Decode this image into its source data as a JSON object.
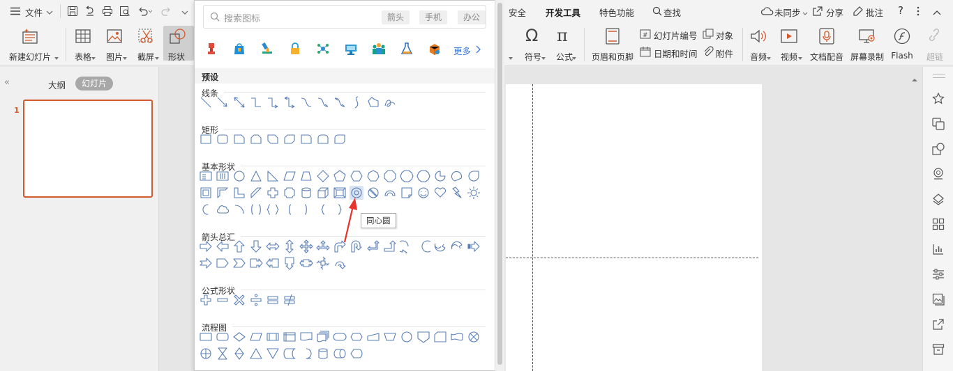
{
  "menubar": {
    "file": "文件",
    "tabs": [
      "安全",
      "开发工具",
      "特色功能"
    ],
    "search": "查找",
    "sync": "未同步",
    "share": "分享",
    "comment": "批注",
    "help": "?"
  },
  "ribbon": {
    "new_slide": "新建幻灯片",
    "table": "表格",
    "picture": "图片",
    "screenshot": "截屏",
    "shape": "形状",
    "symbol": "符号",
    "formula": "公式",
    "header_footer": "页眉和页脚",
    "slide_number": "幻灯片编号",
    "object": "对象",
    "date_time": "日期和时间",
    "attachment": "附件",
    "audio": "音频",
    "video": "视频",
    "doc_voice": "文档配音",
    "screen_record": "屏幕录制",
    "flash": "Flash",
    "hyperlink": "超链"
  },
  "left_panel": {
    "tab_outline": "大纲",
    "tab_slides": "幻灯片",
    "slide_number": "1"
  },
  "shape_panel": {
    "search_placeholder": "搜索图标",
    "search_tags": [
      "箭头",
      "手机",
      "办公"
    ],
    "more": "更多",
    "preset_title": "预设",
    "sections": {
      "lines": "线条",
      "rect": "矩形",
      "basic": "基本形状",
      "arrows": "箭头总汇",
      "equation": "公式形状",
      "flowchart": "流程图"
    },
    "tooltip": "同心圆"
  },
  "colors": {
    "accent": "#d25a2c",
    "shape_stroke": "#5a7fb6",
    "arrow": "#e8322c"
  }
}
